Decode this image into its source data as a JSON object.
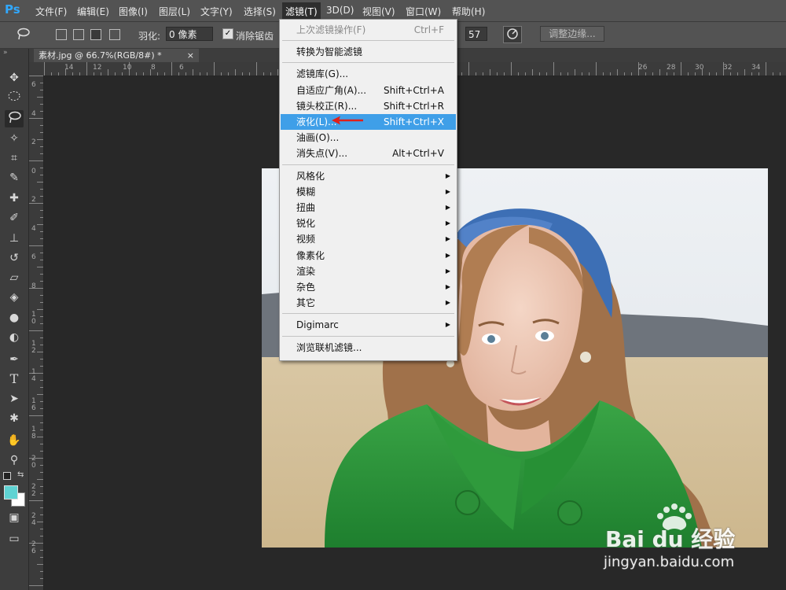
{
  "app": {
    "logo": "Ps"
  },
  "menubar": [
    {
      "label": "文件(F)",
      "active": false
    },
    {
      "label": "编辑(E)",
      "active": false
    },
    {
      "label": "图像(I)",
      "active": false
    },
    {
      "label": "图层(L)",
      "active": false
    },
    {
      "label": "文字(Y)",
      "active": false
    },
    {
      "label": "选择(S)",
      "active": false
    },
    {
      "label": "滤镜(T)",
      "active": true
    },
    {
      "label": "3D(D)",
      "active": false
    },
    {
      "label": "视图(V)",
      "active": false
    },
    {
      "label": "窗口(W)",
      "active": false
    },
    {
      "label": "帮助(H)",
      "active": false
    }
  ],
  "options": {
    "feather_label": "羽化:",
    "feather_value": "0 像素",
    "antialias_label": "消除锯齿",
    "antialias_checked": true,
    "contrast_value": "57",
    "refine_edge_button": "调整边缘..."
  },
  "document": {
    "tab_title": "素材.jpg @ 66.7%(RGB/8#) *",
    "close": "×"
  },
  "rulers": {
    "h_left": [
      "14",
      "12",
      "10",
      "8",
      "6"
    ],
    "h_right": [
      "26",
      "28",
      "30",
      "32",
      "34"
    ],
    "v": [
      "6",
      "4",
      "2",
      "0",
      "2",
      "4",
      "6",
      "8",
      "1 0",
      "1 2",
      "1 4",
      "1 6",
      "1 8",
      "2 0",
      "2 2",
      "2 4",
      "2 6"
    ]
  },
  "filter_menu": {
    "items": [
      {
        "label": "上次滤镜操作(F)",
        "shortcut": "Ctrl+F",
        "disabled": true
      },
      {
        "sep": true
      },
      {
        "label": "转换为智能滤镜"
      },
      {
        "sep": true
      },
      {
        "label": "滤镜库(G)..."
      },
      {
        "label": "自适应广角(A)...",
        "shortcut": "Shift+Ctrl+A"
      },
      {
        "label": "镜头校正(R)...",
        "shortcut": "Shift+Ctrl+R"
      },
      {
        "label": "液化(L)...",
        "shortcut": "Shift+Ctrl+X",
        "highlighted": true
      },
      {
        "label": "油画(O)..."
      },
      {
        "label": "消失点(V)...",
        "shortcut": "Alt+Ctrl+V"
      },
      {
        "sep": true
      },
      {
        "label": "风格化",
        "submenu": true
      },
      {
        "label": "模糊",
        "submenu": true
      },
      {
        "label": "扭曲",
        "submenu": true
      },
      {
        "label": "锐化",
        "submenu": true
      },
      {
        "label": "视频",
        "submenu": true
      },
      {
        "label": "像素化",
        "submenu": true
      },
      {
        "label": "渲染",
        "submenu": true
      },
      {
        "label": "杂色",
        "submenu": true
      },
      {
        "label": "其它",
        "submenu": true
      },
      {
        "sep": true
      },
      {
        "label": "Digimarc",
        "submenu": true
      },
      {
        "sep": true
      },
      {
        "label": "浏览联机滤镜..."
      }
    ]
  },
  "watermark": {
    "brand": "Bai du 经验",
    "url": "jingyan.baidu.com"
  },
  "colors": {
    "highlight": "#3f9fe8",
    "arrow": "#e0201a",
    "foreground_swatch": "#5fd3d3"
  }
}
